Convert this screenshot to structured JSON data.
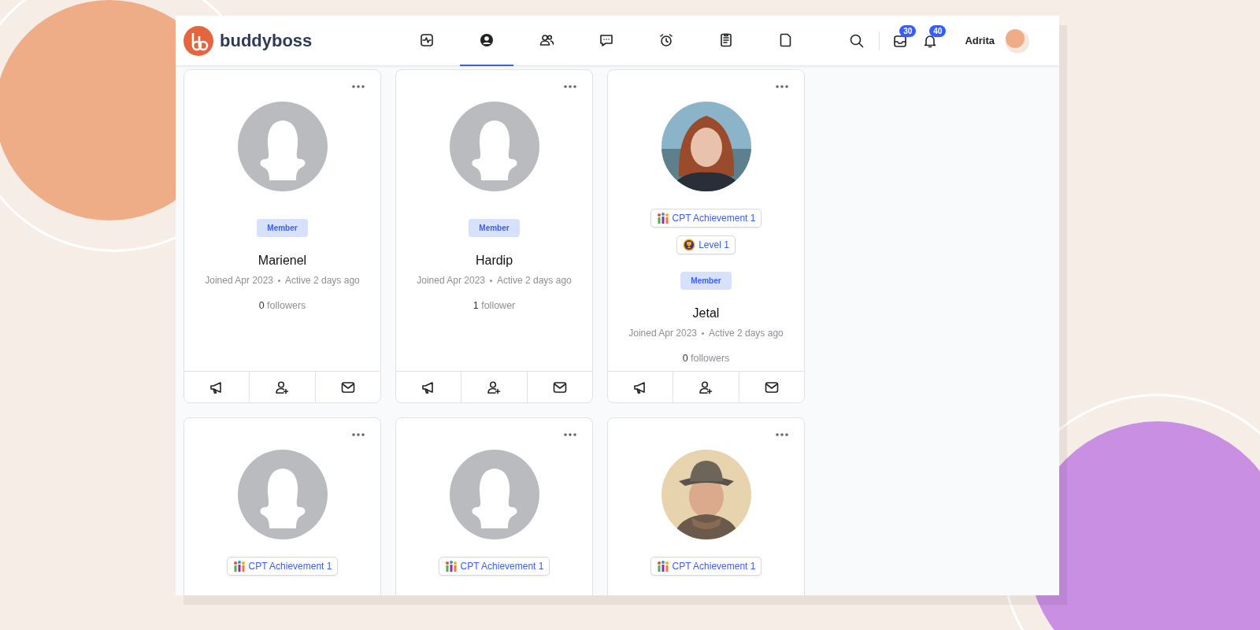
{
  "header": {
    "brand": "buddyboss",
    "nav": [
      {
        "selected": false
      },
      {
        "selected": true
      },
      {
        "selected": false
      },
      {
        "selected": false
      },
      {
        "selected": false
      },
      {
        "selected": false
      },
      {
        "selected": false
      }
    ],
    "messages_count": "30",
    "notifications_count": "40",
    "user_name": "Adrita"
  },
  "members": [
    {
      "member_type": "Member",
      "name": "Marienel",
      "joined": "Joined Apr 2023",
      "active": "Active 2 days ago",
      "followers_count": "0",
      "followers_label": "followers"
    },
    {
      "member_type": "Member",
      "name": "Hardip",
      "joined": "Joined Apr 2023",
      "active": "Active 2 days ago",
      "followers_count": "1",
      "followers_label": "follower"
    },
    {
      "kind": "picture",
      "badges": [
        {
          "kind": "achievement",
          "label": "CPT Achievement 1"
        },
        {
          "kind": "level",
          "label": "Level 1"
        }
      ],
      "member_type": "Member",
      "name": "Jetal",
      "joined": "Joined Apr 2023",
      "active": "Active 2 days ago",
      "followers_count": "0",
      "followers_label": "followers"
    },
    {
      "badges": [
        {
          "kind": "achievement",
          "label": "CPT Achievement 1"
        }
      ]
    },
    {
      "badges": [
        {
          "kind": "achievement",
          "label": "CPT Achievement 1"
        }
      ]
    },
    {
      "kind": "picture",
      "badges": [
        {
          "kind": "achievement",
          "label": "CPT Achievement 1"
        }
      ]
    }
  ]
}
